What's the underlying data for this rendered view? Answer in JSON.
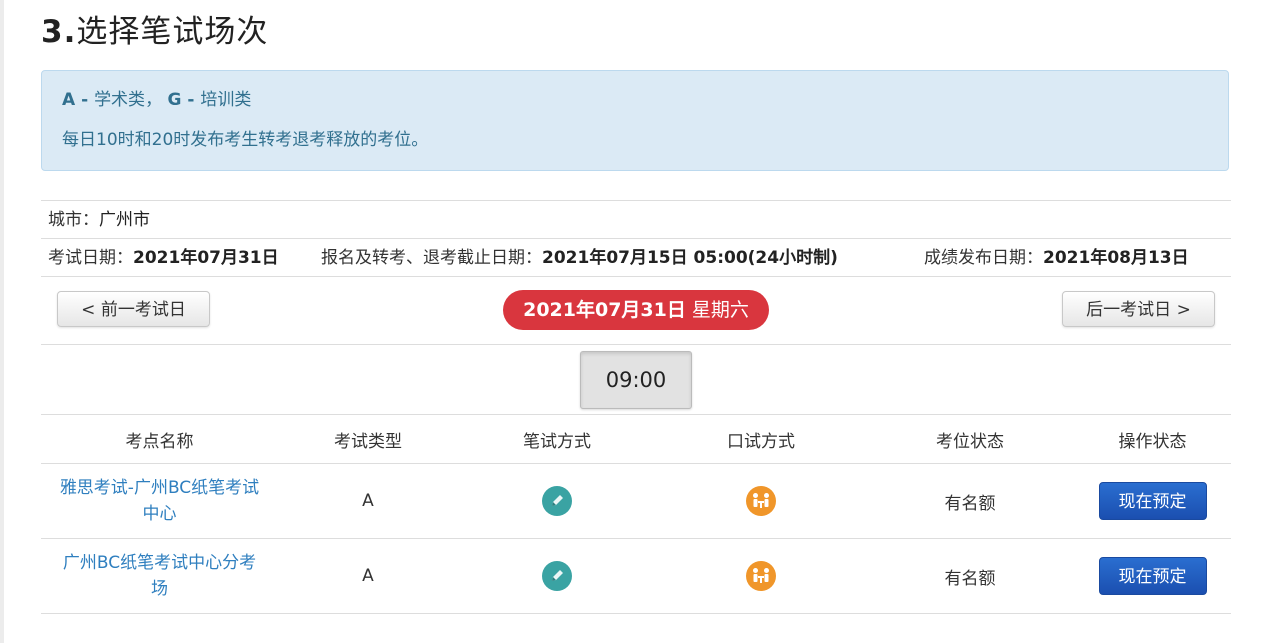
{
  "page": {
    "title_num": "3.",
    "title_text": "选择笔试场次"
  },
  "notice": {
    "a_code": "A - ",
    "a_text": "学术类",
    "sep": "， ",
    "g_code": "G - ",
    "g_text": "培训类",
    "release_text": "每日10时和20时发布考生转考退考释放的考位。"
  },
  "info": {
    "city_label": "城市：",
    "city_value": "广州市",
    "exam_date_label": "考试日期：",
    "exam_date_value": "2021年07月31日",
    "deadline_label": "报名及转考、退考截止日期：",
    "deadline_value": "2021年07月15日 05:00(24小时制)",
    "result_label": "成绩发布日期：",
    "result_value": "2021年08月13日"
  },
  "nav": {
    "prev_label": "< 前一考试日",
    "next_label": "后一考试日 >",
    "current_date": "2021年07月31日",
    "current_weekday": " 星期六",
    "current_color": "#d9363e"
  },
  "time_slot": {
    "selected": "09:00"
  },
  "table": {
    "headers": [
      "考点名称",
      "考试类型",
      "笔试方式",
      "口试方式",
      "考位状态",
      "操作状态"
    ],
    "rows": [
      {
        "venue_line1": "雅思考试-广州BC纸笔考试",
        "venue_line2": "中心",
        "type": "A",
        "written_icon": "pencil-icon",
        "speaking_icon": "face-to-face-icon",
        "status": "有名额",
        "action": "现在预定"
      },
      {
        "venue_line1": "广州BC纸笔考试中心分考",
        "venue_line2": "场",
        "type": "A",
        "written_icon": "pencil-icon",
        "speaking_icon": "face-to-face-icon",
        "status": "有名额",
        "action": "现在预定"
      }
    ]
  },
  "colors": {
    "pencil_icon_bg": "#3aa3a3",
    "speaking_icon_bg": "#f0962a",
    "book_button": "#1f5cc0",
    "link": "#2f7fbf"
  }
}
